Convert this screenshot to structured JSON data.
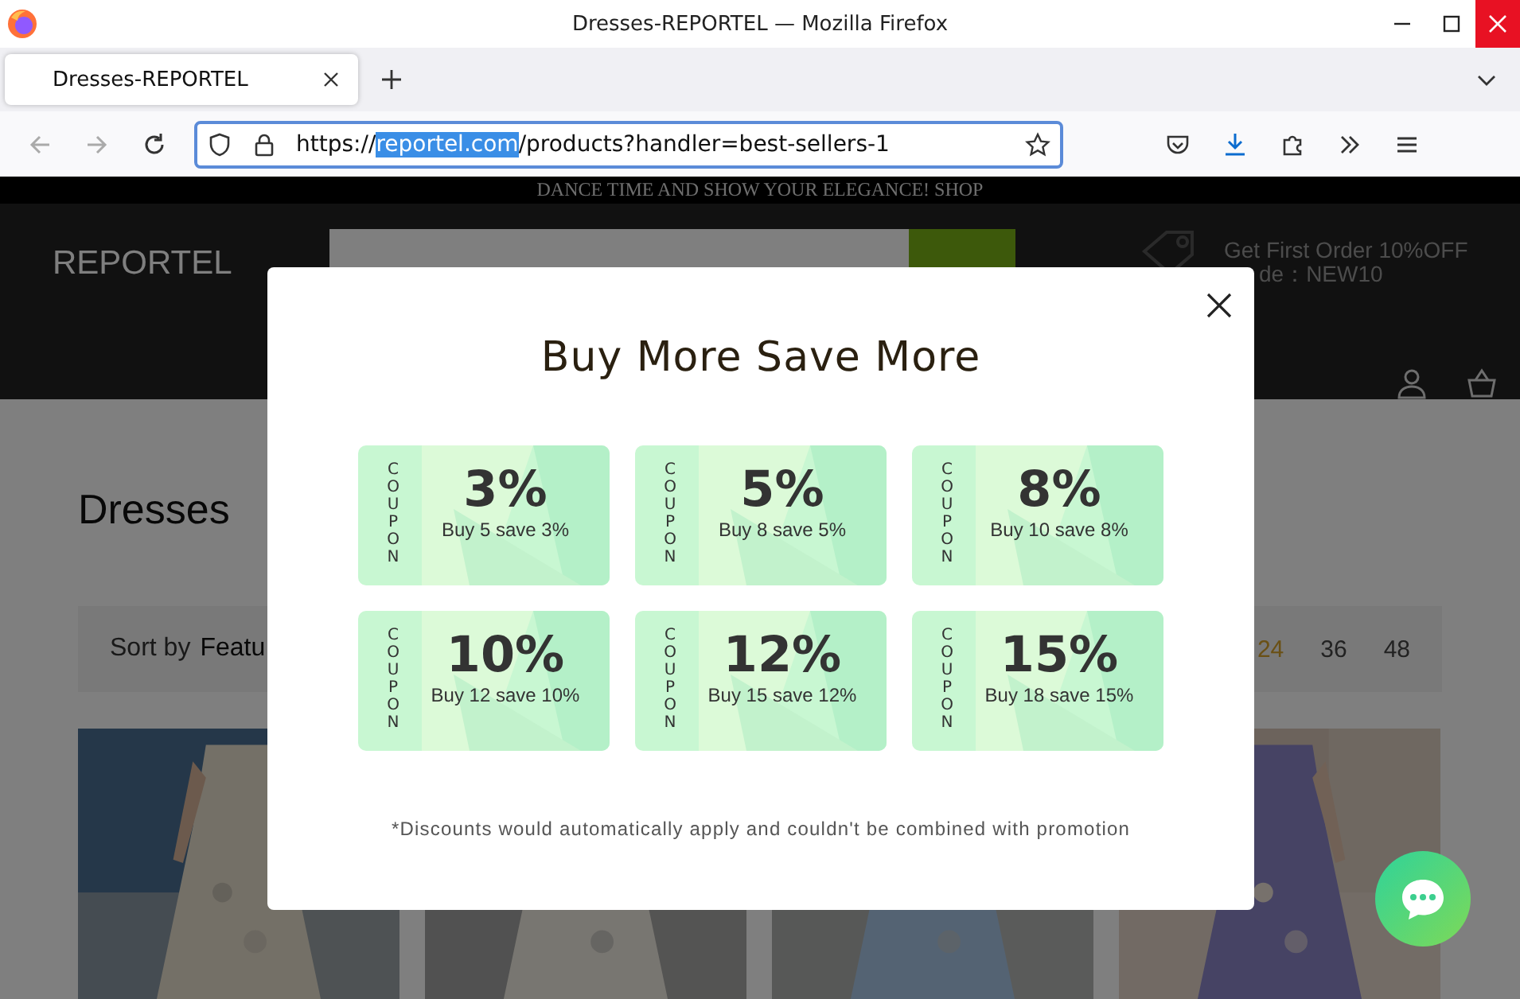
{
  "window": {
    "title": "Dresses-REPORTEL — Mozilla Firefox"
  },
  "tabs": [
    {
      "label": "Dresses-REPORTEL",
      "selected": true
    }
  ],
  "address_bar": {
    "prefix": "https://",
    "highlighted": "reportel.com",
    "suffix": "/products?handler=best-sellers-1"
  },
  "page": {
    "promo_bar": "DANCE TIME AND SHOW YOUR ELEGANCE!  SHOP",
    "header": {
      "logo": "REPORTEL",
      "offer_lines": [
        "Get First Order 10%OFF",
        "de：NEW10"
      ]
    },
    "heading": "Dresses",
    "sort": {
      "label": "Sort by",
      "value": "Featu"
    },
    "per_page": [
      {
        "label": "24",
        "selected": true
      },
      {
        "label": "36",
        "selected": false
      },
      {
        "label": "48",
        "selected": false
      }
    ]
  },
  "modal": {
    "title": "Buy More Save More",
    "coupons": [
      {
        "label": "COUPON",
        "percent": "3%",
        "text": "Buy 5 save 3%"
      },
      {
        "label": "COUPON",
        "percent": "5%",
        "text": "Buy 8 save 5%"
      },
      {
        "label": "COUPON",
        "percent": "8%",
        "text": "Buy 10 save 8%"
      },
      {
        "label": "COUPON",
        "percent": "10%",
        "text": "Buy 12 save 10%"
      },
      {
        "label": "COUPON",
        "percent": "12%",
        "text": "Buy 15 save 12%"
      },
      {
        "label": "COUPON",
        "percent": "15%",
        "text": "Buy 18 save 15%"
      }
    ],
    "note": "*Discounts would automatically apply and couldn't be combined with promotion"
  }
}
